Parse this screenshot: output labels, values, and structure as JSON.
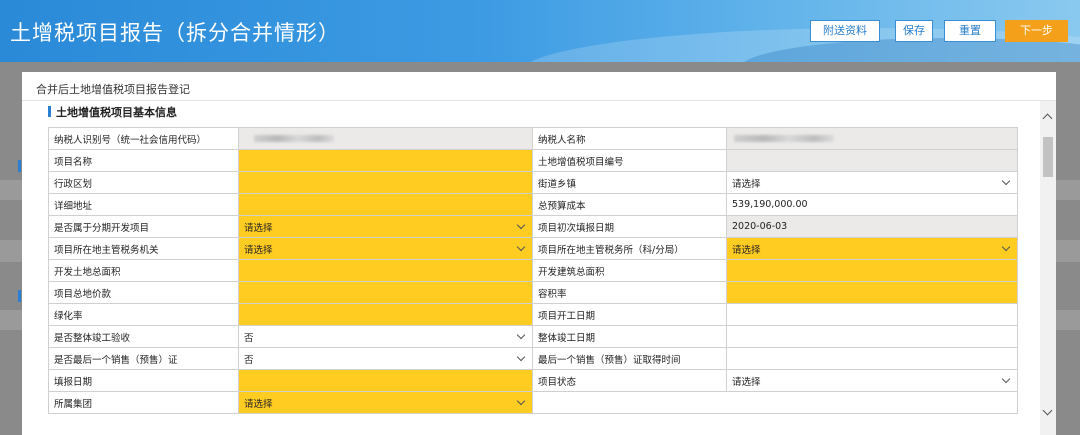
{
  "header": {
    "title": "土增税项目报告（拆分合并情形）",
    "buttons": {
      "attach": "附送资料",
      "save": "保存",
      "reset": "重置",
      "next": "下一步"
    }
  },
  "panel": {
    "title": "合并后土地增值税项目报告登记",
    "section_title": "土地增值税项目基本信息"
  },
  "form": {
    "r0": {
      "l1": "纳税人识别号（统一社会信用代码）",
      "l2": "纳税人名称"
    },
    "r1": {
      "l1": "项目名称",
      "l2": "土地增值税项目编号"
    },
    "r2": {
      "l1": "行政区划",
      "l2": "街道乡镇",
      "v2": "请选择"
    },
    "r3": {
      "l1": "详细地址",
      "l2": "总预算成本",
      "v2": "539,190,000.00"
    },
    "r4": {
      "l1": "是否属于分期开发项目",
      "v1": "请选择",
      "l2": "项目初次填报日期",
      "v2": "2020-06-03"
    },
    "r5": {
      "l1": "项目所在地主管税务机关",
      "v1": "请选择",
      "l2": "项目所在地主管税务所（科/分局）",
      "v2": "请选择"
    },
    "r6": {
      "l1": "开发土地总面积",
      "l2": "开发建筑总面积"
    },
    "r7": {
      "l1": "项目总地价款",
      "l2": "容积率"
    },
    "r8": {
      "l1": "绿化率",
      "l2": "项目开工日期"
    },
    "r9": {
      "l1": "是否整体竣工验收",
      "v1": "否",
      "l2": "整体竣工日期"
    },
    "r10": {
      "l1": "是否最后一个销售（预售）证",
      "v1": "否",
      "l2": "最后一个销售（预售）证取得时间"
    },
    "r11": {
      "l1": "填报日期",
      "l2": "项目状态",
      "v2": "请选择"
    },
    "r12": {
      "l1": "所属集团",
      "v1": "请选择"
    }
  },
  "colors": {
    "required_field": "#ffcc22",
    "readonly_field": "#ece9e9",
    "header_blue": "#2a8ad8",
    "next_button": "#f5a01a"
  }
}
